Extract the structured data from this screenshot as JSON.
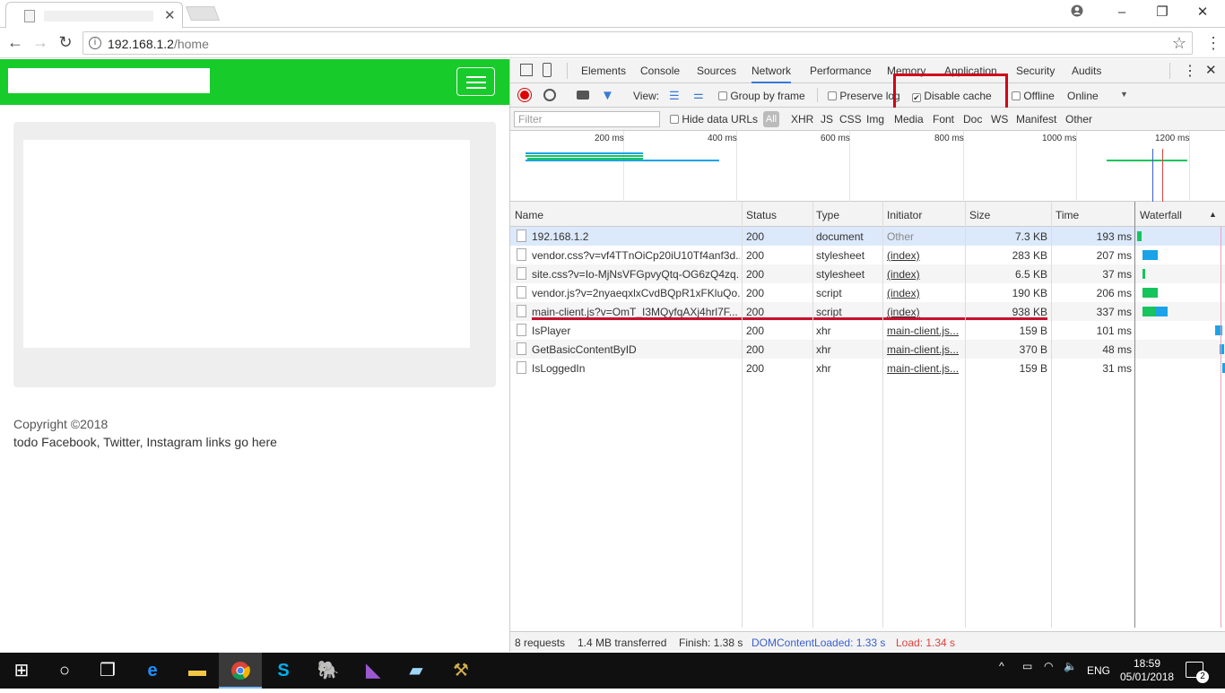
{
  "browser": {
    "tab_close": "✕",
    "url_host": "192.168.1.2",
    "url_path": "/home",
    "window_controls": [
      "minimize",
      "maximize",
      "close"
    ],
    "profile_icon": "person-icon"
  },
  "page": {
    "footer_copyright": "Copyright ©2018",
    "footer_links": "todo Facebook, Twitter, Instagram links go here",
    "navbar_color": "#17cb2b"
  },
  "devtools": {
    "tabs": [
      "Elements",
      "Console",
      "Sources",
      "Network",
      "Performance",
      "Memory",
      "Application",
      "Security",
      "Audits"
    ],
    "active_tab": "Network",
    "toolbar": {
      "view_label": "View:",
      "group_by_frame": "Group by frame",
      "preserve_log": "Preserve log",
      "disable_cache": "Disable cache",
      "disable_cache_checked": true,
      "offline": "Offline",
      "throttle": "Online"
    },
    "filter": {
      "placeholder": "Filter",
      "hide_data_urls": "Hide data URLs",
      "types": [
        "All",
        "XHR",
        "JS",
        "CSS",
        "Img",
        "Media",
        "Font",
        "Doc",
        "WS",
        "Manifest",
        "Other"
      ]
    },
    "timeline_ticks": [
      "200 ms",
      "400 ms",
      "600 ms",
      "800 ms",
      "1000 ms",
      "1200 ms"
    ],
    "columns": [
      "Name",
      "Status",
      "Type",
      "Initiator",
      "Size",
      "Time",
      "Waterfall"
    ],
    "rows": [
      {
        "name": "192.168.1.2",
        "status": "200",
        "type": "document",
        "initiator": "Other",
        "size": "7.3 KB",
        "time": "193 ms"
      },
      {
        "name": "vendor.css?v=vf4TTnOiCp20iU10Tf4anf3d...",
        "status": "200",
        "type": "stylesheet",
        "initiator": "(index)",
        "size": "283 KB",
        "time": "207 ms"
      },
      {
        "name": "site.css?v=Io-MjNsVFGpvyQtq-OG6zQ4zq...",
        "status": "200",
        "type": "stylesheet",
        "initiator": "(index)",
        "size": "6.5 KB",
        "time": "37 ms"
      },
      {
        "name": "vendor.js?v=2nyaeqxlxCvdBQpR1xFKluQo...",
        "status": "200",
        "type": "script",
        "initiator": "(index)",
        "size": "190 KB",
        "time": "206 ms"
      },
      {
        "name": "main-client.js?v=OmT_I3MQyfqAXj4hrl7F...",
        "status": "200",
        "type": "script",
        "initiator": "(index)",
        "size": "938 KB",
        "time": "337 ms"
      },
      {
        "name": "IsPlayer",
        "status": "200",
        "type": "xhr",
        "initiator": "main-client.js...",
        "size": "159 B",
        "time": "101 ms"
      },
      {
        "name": "GetBasicContentByID",
        "status": "200",
        "type": "xhr",
        "initiator": "main-client.js...",
        "size": "370 B",
        "time": "48 ms"
      },
      {
        "name": "IsLoggedIn",
        "status": "200",
        "type": "xhr",
        "initiator": "main-client.js...",
        "size": "159 B",
        "time": "31 ms"
      }
    ],
    "status": {
      "requests": "8 requests",
      "transferred": "1.4 MB transferred",
      "finish": "Finish: 1.38 s",
      "dcl": "DOMContentLoaded: 1.33 s",
      "load": "Load: 1.34 s"
    },
    "highlight_color": "#d0021b",
    "underline_color": "#c8102e"
  },
  "taskbar": {
    "apps": [
      "windows-start-icon",
      "cortana-icon",
      "task-view-icon",
      "edge-icon",
      "file-explorer-icon",
      "chrome-icon",
      "skype-icon",
      "postgres-icon",
      "visual-studio-icon",
      "notepad-icon",
      "tool-icon"
    ],
    "language": "ENG",
    "time": "18:59",
    "date": "05/01/2018",
    "notifications": "2"
  }
}
